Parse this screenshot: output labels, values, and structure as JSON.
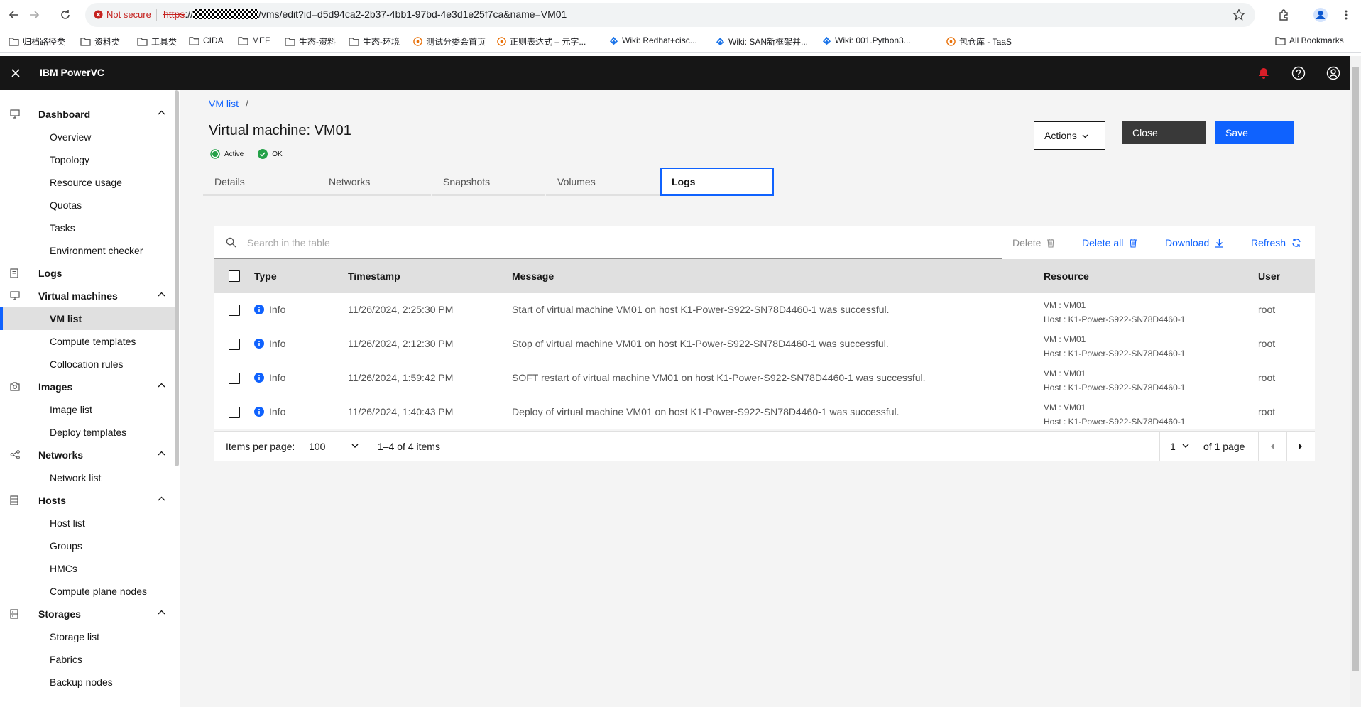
{
  "browser": {
    "not_secure": "Not secure",
    "url_scheme": "https",
    "url_rest": "/vms/edit?id=d5d94ca2-2b37-4bb1-97bd-4e3d1e25f7ca&name=VM01",
    "bookmarks": [
      {
        "label": "归档路径类",
        "icon": "folder-icon"
      },
      {
        "label": "资料类",
        "icon": "folder-icon"
      },
      {
        "label": "工具类",
        "icon": "folder-icon"
      },
      {
        "label": "CIDA",
        "icon": "folder-icon"
      },
      {
        "label": "MEF",
        "icon": "folder-icon"
      },
      {
        "label": "生态-资料",
        "icon": "folder-icon"
      },
      {
        "label": "生态-环境",
        "icon": "folder-icon"
      },
      {
        "label": "测试分委会首页",
        "icon": "site-icon"
      },
      {
        "label": "正则表达式 – 元字...",
        "icon": "site-icon"
      },
      {
        "label": "Wiki: Redhat+cisc...",
        "icon": "wiki-icon"
      },
      {
        "label": "Wiki: SAN新框架并...",
        "icon": "wiki-icon"
      },
      {
        "label": "Wiki: 001.Python3...",
        "icon": "wiki-icon"
      },
      {
        "label": "包仓库 - TaaS",
        "icon": "site-icon"
      }
    ],
    "all_bookmarks": "All Bookmarks"
  },
  "app": {
    "title": "IBM PowerVC"
  },
  "sidebar": {
    "groups": [
      {
        "label": "Dashboard",
        "icon": "monitor-icon",
        "items": [
          "Overview",
          "Topology",
          "Resource usage",
          "Quotas",
          "Tasks",
          "Environment checker"
        ]
      },
      {
        "label": "Logs",
        "icon": "document-icon",
        "items": []
      },
      {
        "label": "Virtual machines",
        "icon": "monitor-icon",
        "items": [
          "VM list",
          "Compute templates",
          "Collocation rules"
        ]
      },
      {
        "label": "Images",
        "icon": "camera-icon",
        "items": [
          "Image list",
          "Deploy templates"
        ]
      },
      {
        "label": "Networks",
        "icon": "network-icon",
        "items": [
          "Network list"
        ]
      },
      {
        "label": "Hosts",
        "icon": "server-icon",
        "items": [
          "Host list",
          "Groups",
          "HMCs",
          "Compute plane nodes"
        ]
      },
      {
        "label": "Storages",
        "icon": "storage-icon",
        "items": [
          "Storage list",
          "Fabrics",
          "Backup nodes"
        ]
      }
    ],
    "active_item": "VM list"
  },
  "page": {
    "breadcrumb": "VM list",
    "breadcrumb_sep": "/",
    "title": "Virtual machine: VM01",
    "status_state": "Active",
    "status_health": "OK",
    "actions_label": "Actions",
    "close_label": "Close",
    "save_label": "Save",
    "tabs": [
      "Details",
      "Networks",
      "Snapshots",
      "Volumes",
      "Logs"
    ],
    "active_tab": "Logs"
  },
  "table": {
    "search_placeholder": "Search in the table",
    "delete_label": "Delete",
    "delete_all_label": "Delete all",
    "download_label": "Download",
    "refresh_label": "Refresh",
    "columns": [
      "Type",
      "Timestamp",
      "Message",
      "Resource",
      "User"
    ],
    "rows": [
      {
        "type": "Info",
        "timestamp": "11/26/2024, 2:25:30 PM",
        "message": "Start of virtual machine VM01 on host K1-Power-S922-SN78D4460-1 was successful.",
        "res_vm": "VM : VM01",
        "res_host": "Host : K1-Power-S922-SN78D4460-1",
        "user": "root"
      },
      {
        "type": "Info",
        "timestamp": "11/26/2024, 2:12:30 PM",
        "message": "Stop of virtual machine VM01 on host K1-Power-S922-SN78D4460-1 was successful.",
        "res_vm": "VM : VM01",
        "res_host": "Host : K1-Power-S922-SN78D4460-1",
        "user": "root"
      },
      {
        "type": "Info",
        "timestamp": "11/26/2024, 1:59:42 PM",
        "message": "SOFT restart of virtual machine VM01 on host K1-Power-S922-SN78D4460-1 was successful.",
        "res_vm": "VM : VM01",
        "res_host": "Host : K1-Power-S922-SN78D4460-1",
        "user": "root"
      },
      {
        "type": "Info",
        "timestamp": "11/26/2024, 1:40:43 PM",
        "message": "Deploy of virtual machine VM01 on host K1-Power-S922-SN78D4460-1 was successful.",
        "res_vm": "VM : VM01",
        "res_host": "Host : K1-Power-S922-SN78D4460-1",
        "user": "root"
      }
    ],
    "pagination": {
      "items_per_page_label": "Items per page:",
      "items_per_page": "100",
      "range": "1–4 of 4 items",
      "page": "1",
      "of_pages": "of 1 page"
    }
  },
  "colors": {
    "brand_blue": "#0f62fe",
    "header_bg": "#161616",
    "status_green": "#24a148",
    "notification_red": "#da1e28"
  }
}
